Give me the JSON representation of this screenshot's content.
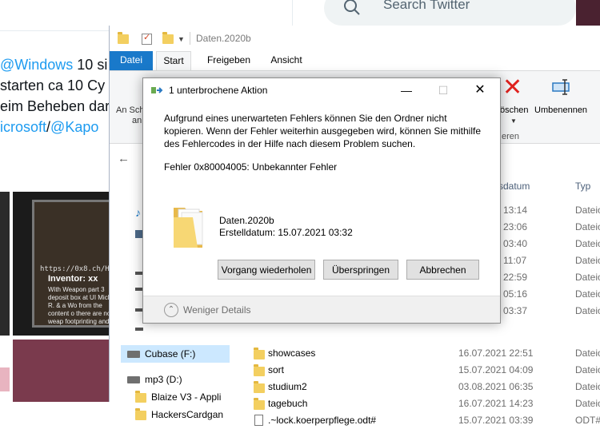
{
  "twitter": {
    "search_placeholder": "Search Twitter",
    "lines": [
      {
        "pre": "",
        "link": "@Windows",
        "post": " 10 si"
      },
      {
        "pre": " starten ca 10 Cy",
        "link": "",
        "post": ""
      },
      {
        "pre": "eim Beheben dar",
        "link": "",
        "post": ""
      },
      {
        "pre": "",
        "link": "icrosoft",
        "post": "/",
        "link2": "@Kapo"
      }
    ],
    "card_url": "https://0x8.ch/H",
    "card_title": "Inventor: xx",
    "card_text": "With Weapon part 3 deposit box at UI Michael R. & a Wo from the content o there are no weap footprinting and em"
  },
  "explorer": {
    "title": "Daten.2020b",
    "tabs": [
      "Datei",
      "Start",
      "Freigeben",
      "Ansicht"
    ],
    "ribbon": {
      "left_label_line1": "An Sch",
      "left_label_line2": "an",
      "delete_label": "öschen",
      "rename_label": "Umbenennen",
      "group_label": "eren"
    },
    "nav_items": [
      {
        "label": "Cubase (F:)",
        "type": "drive",
        "selected": true
      },
      {
        "label": "mp3 (D:)",
        "type": "drive",
        "selected": false
      },
      {
        "label": "Blaize V3 - Appli",
        "type": "folder",
        "selected": false
      },
      {
        "label": "HackersCardgan",
        "type": "folder",
        "selected": false
      }
    ],
    "columns": {
      "date": "sdatum",
      "type": "Typ"
    },
    "top_rows": [
      {
        "date": "13:14",
        "type": "Dateio"
      },
      {
        "date": "23:06",
        "type": "Dateio"
      },
      {
        "date": "03:40",
        "type": "Dateio"
      },
      {
        "date": "11:07",
        "type": "Dateio"
      },
      {
        "date": "22:59",
        "type": "Dateio"
      },
      {
        "date": "05:16",
        "type": "Dateio"
      },
      {
        "date": "03:37",
        "type": "Dateio"
      }
    ],
    "rows": [
      {
        "name": "showcases",
        "date": "16.07.2021 22:51",
        "type": "Dateio",
        "icon": "folder"
      },
      {
        "name": "sort",
        "date": "15.07.2021 04:09",
        "type": "Dateio",
        "icon": "folder"
      },
      {
        "name": "studium2",
        "date": "03.08.2021 06:35",
        "type": "Dateio",
        "icon": "folder"
      },
      {
        "name": "tagebuch",
        "date": "16.07.2021 14:23",
        "type": "Dateio",
        "icon": "folder"
      },
      {
        "name": ".~lock.koerperpflege.odt#",
        "date": "15.07.2021 03:39",
        "type": "ODT#-",
        "icon": "file"
      }
    ]
  },
  "dialog": {
    "title": "1 unterbrochene Aktion",
    "min_glyph": "—",
    "max_glyph": "☐",
    "close_glyph": "✕",
    "message": "Aufgrund eines unerwarteten Fehlers können Sie den Ordner nicht kopieren. Wenn der Fehler weiterhin ausgegeben wird, können Sie mithilfe des Fehlercodes in der Hilfe nach diesem Problem suchen.",
    "error_code": "Fehler 0x80004005: Unbekannter Fehler",
    "item_name": "Daten.2020b",
    "item_date": "Erstelldatum: 15.07.2021 03:32",
    "buttons": {
      "retry": "Vorgang wiederholen",
      "skip": "Überspringen",
      "cancel": "Abbrechen"
    },
    "footer_label": "Weniger Details",
    "footer_chevron": "⌃"
  },
  "colors": {
    "accent": "#1979ca",
    "delete_red": "#e0231f",
    "twitter_blue": "#1d9bf0"
  }
}
